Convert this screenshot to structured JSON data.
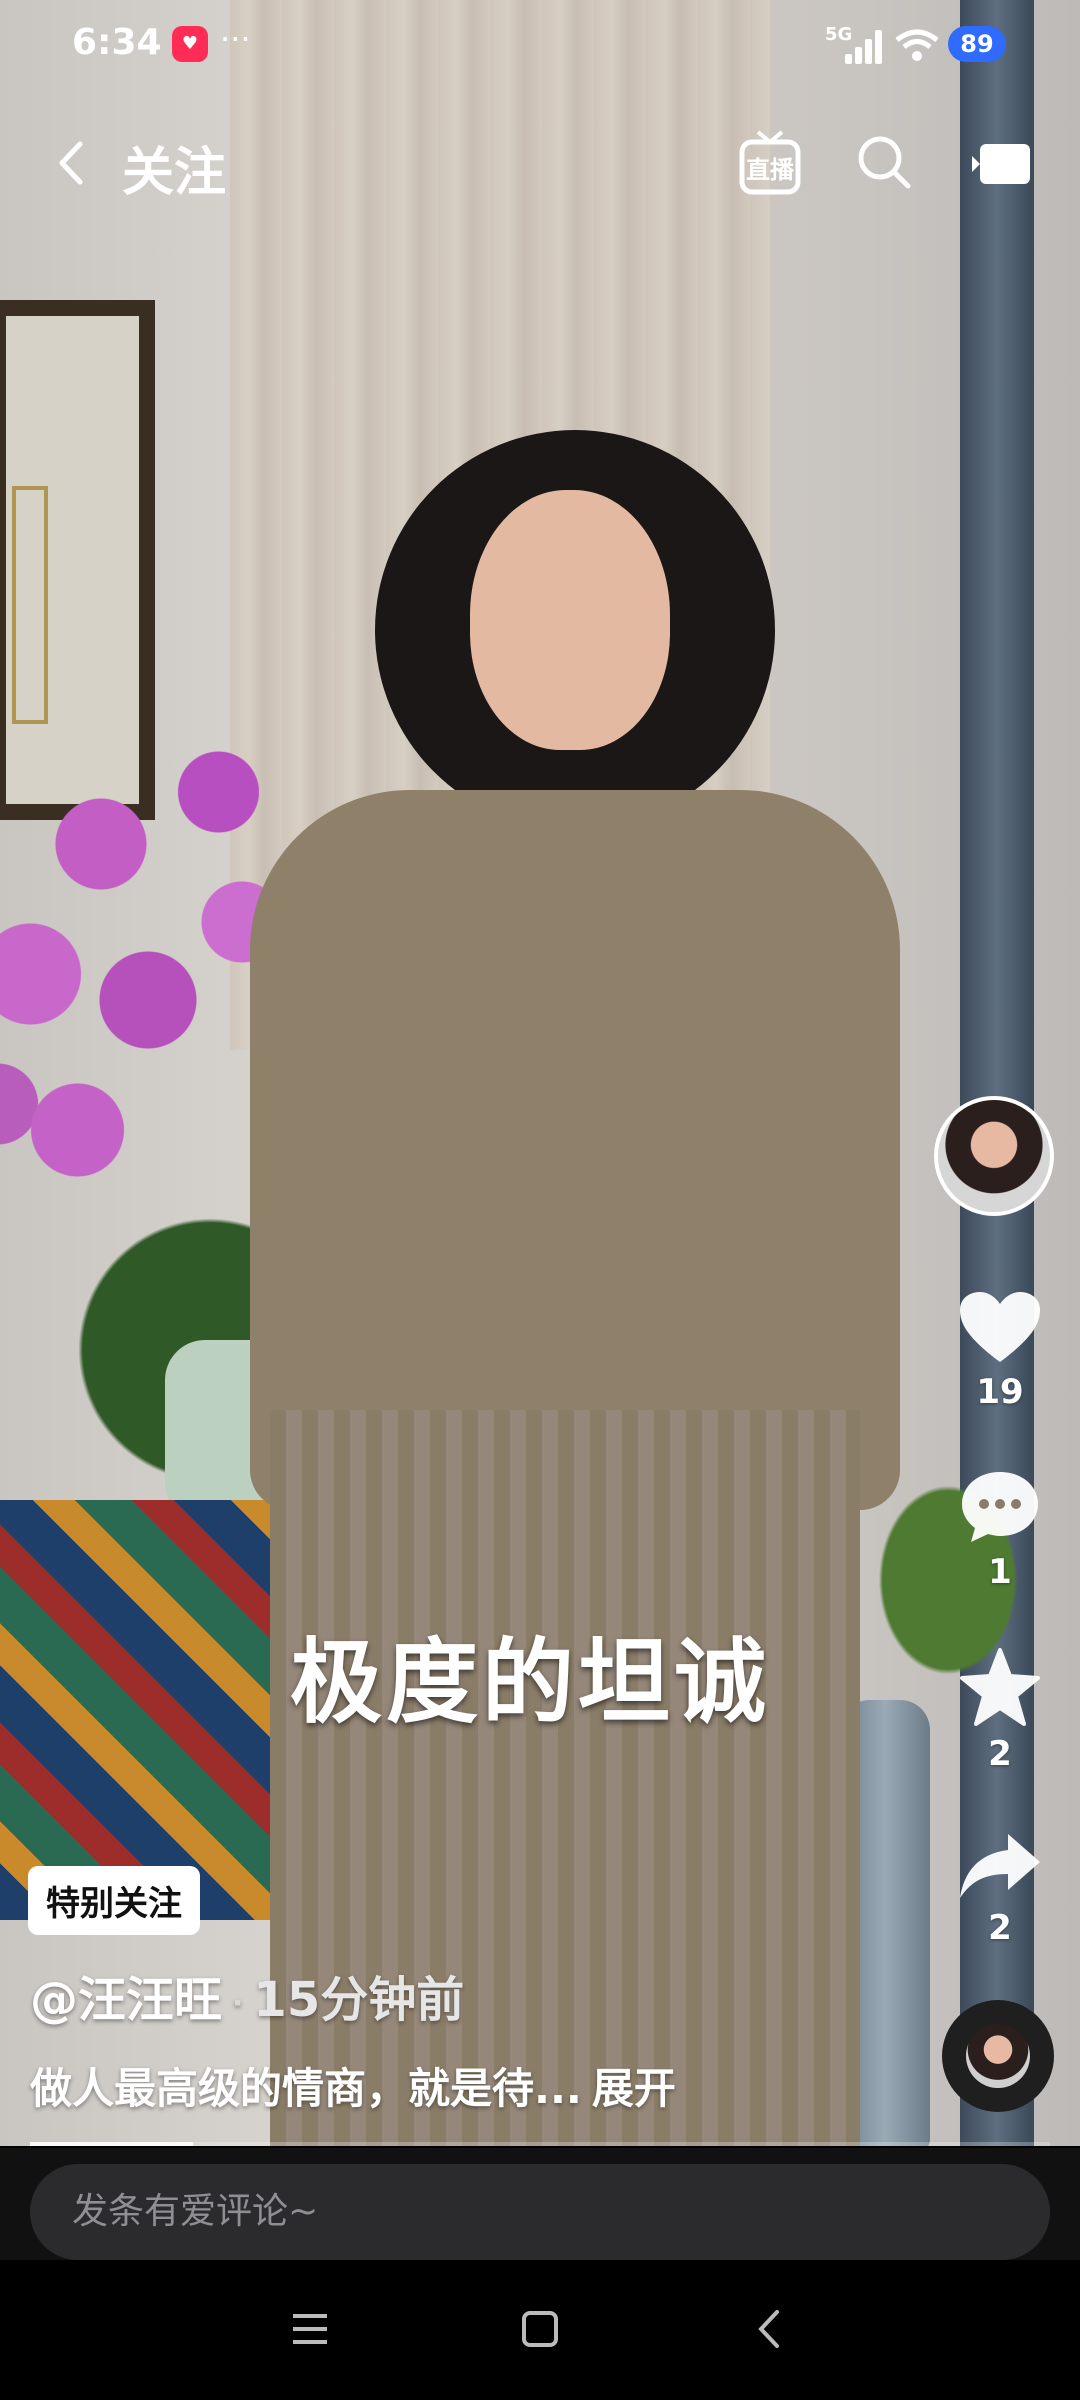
{
  "status_bar": {
    "time": "6:34",
    "app_badge_icon": "red-app-badge-icon",
    "more": "···",
    "network": "5G",
    "battery": "89"
  },
  "nav": {
    "back_icon": "chevron-left-icon",
    "title": "关注",
    "live_label": "直播",
    "search_icon": "search-icon",
    "tv_icon": "tv-icon"
  },
  "video": {
    "subtitle": "极度的坦诚",
    "progress_fraction": 0.16
  },
  "actions": {
    "like_count": "19",
    "comment_count": "1",
    "favorite_count": "2",
    "share_count": "2"
  },
  "info": {
    "special_tag": "特别关注",
    "author": "@汪汪旺",
    "separator": "·",
    "time_ago": "15分钟前",
    "description": "做人最高级的情商，就是待...",
    "expand": "展开"
  },
  "comment": {
    "placeholder": "发条有爱评论~"
  },
  "system_nav": {
    "menu_icon": "menu-icon",
    "home_icon": "home-square-icon",
    "back_icon": "back-triangle-icon"
  },
  "colors": {
    "battery": "#2f6bff",
    "comment_bg": "#2b2b2d",
    "tag_bg": "#ffffff"
  }
}
